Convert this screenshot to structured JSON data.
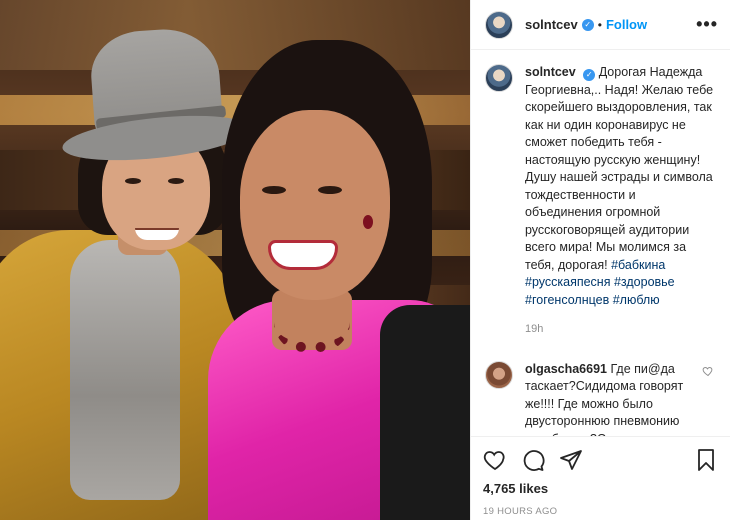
{
  "post": {
    "author": "solntcev",
    "follow_label": "Follow",
    "separator": "•",
    "more_label": "•••",
    "caption": "Дорогая Надежда Георгиевна,.. Надя! Желаю тебе скорейшего выздоровления, так как ни один коронавирус не сможет победить тебя - настоящую русскую женщину! Душу нашей эстрады и символа тождественности и объединения огромной русскоговорящей аудитории всего мира! Мы молимся за тебя, дорогая!",
    "hashtags": [
      "#бабкина",
      "#русскаяпесня",
      "#здоровье",
      "#гогенсолнцев",
      "#люблю"
    ],
    "caption_time": "19h",
    "likes": "4,765 likes",
    "time_ago": "19 HOURS AGO"
  },
  "comments": [
    {
      "user": "olgascha6691",
      "text": "Где пи@да таскает?Сидидома говорят же!!!! Где можно было двустороннюю пневмонию заработать?Старая манда,таскается где?????"
    }
  ],
  "icons": {
    "verified": "verified-badge-icon",
    "like": "heart-icon",
    "comment": "comment-bubble-icon",
    "share": "paper-plane-icon",
    "save": "bookmark-icon",
    "more": "more-options-icon"
  },
  "colors": {
    "accent": "#0095f6",
    "verified": "#3897f0",
    "hashtag": "#00376b",
    "muted": "#8e8e8e",
    "text": "#262626",
    "border": "#efefef"
  }
}
